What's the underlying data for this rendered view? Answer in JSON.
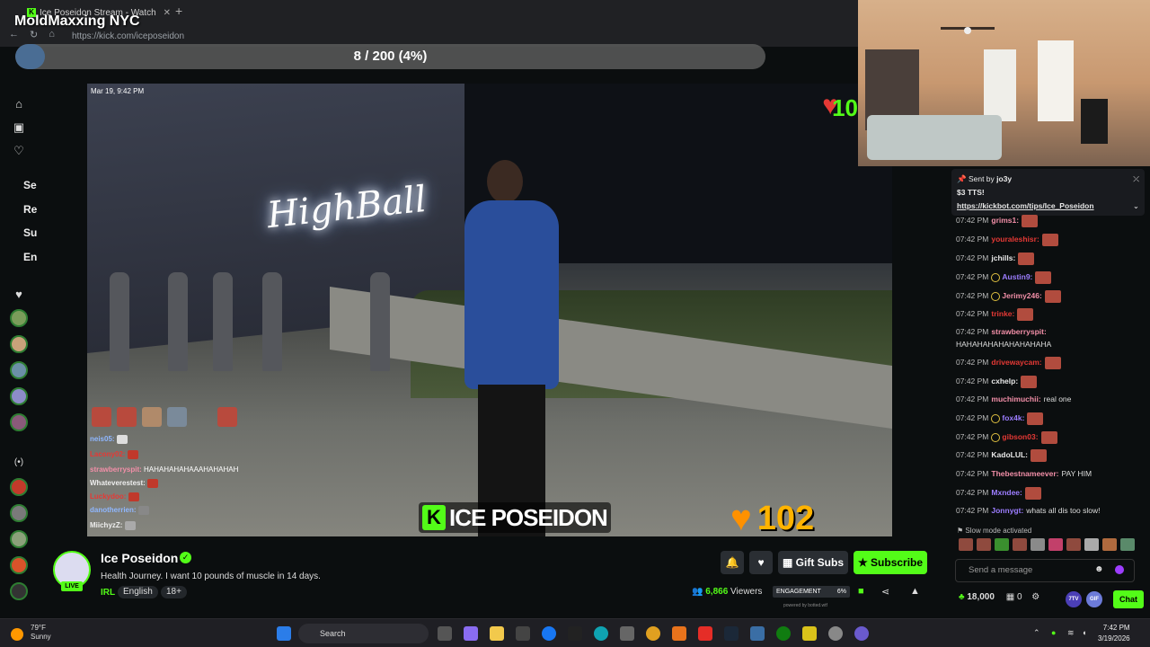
{
  "browser": {
    "tab_title": "Ice Poseidon Stream - Watch",
    "tab_close": "✕",
    "new_tab": "+",
    "url": "https://kick.com/iceposeidon"
  },
  "overlay": {
    "title": "MoldMaxxing NYC",
    "progress_text": "8 / 200 (4%)",
    "progress_fraction": 0.04
  },
  "sidebar": {
    "labels": [
      "Se",
      "Re",
      "Su",
      "En"
    ],
    "section_icon": "(•)"
  },
  "video": {
    "timestamp": "Mar 19, 9:42 PM",
    "sign_text": "HighBall",
    "heart_number": "10",
    "logo_k": "K",
    "logo_text": "ICE POSEIDON",
    "like_count": "102",
    "chat_overlay": [
      {
        "user": "neis05:",
        "text": ""
      },
      {
        "user": "Lacony02:",
        "text": ""
      },
      {
        "user": "strawberryspit:",
        "text": "HAHAHAHAHAAAHAHAHAH"
      },
      {
        "user": "Whateverestest:",
        "text": ""
      },
      {
        "user": "Luckydoo:",
        "text": ""
      },
      {
        "user": "danotherrien:",
        "text": ""
      },
      {
        "user": "MiichyzZ:",
        "text": ""
      }
    ]
  },
  "channel": {
    "name": "Ice Poseidon",
    "verified_mark": "✓",
    "live_label": "LIVE",
    "stream_title": "Health Journey. I want 10 pounds of muscle in 14 days.",
    "category": "IRL",
    "tags": [
      "English",
      "18+"
    ],
    "gift_label": "Gift Subs",
    "subscribe_label": "Subscribe",
    "viewers": "6,866",
    "viewers_label": "Viewers",
    "engagement_label": "ENGAGEMENT",
    "engagement_pct": "6%",
    "powered": "powered by botted.wtf"
  },
  "chat": {
    "pinned": {
      "sent_by_prefix": "Sent by",
      "sent_by_user": "jo3y",
      "amount": "$3 TTS!",
      "link": "https://kickbot.com/tips/Ice_Poseidon"
    },
    "messages": [
      {
        "time": "07:42 PM",
        "user": "grims1:",
        "text": "",
        "color": "#f28fa8",
        "badge": false,
        "emote": true
      },
      {
        "time": "07:42 PM",
        "user": "youraleshisr:",
        "text": "",
        "color": "#e53935",
        "badge": false,
        "emote": true
      },
      {
        "time": "07:42 PM",
        "user": "jchills:",
        "text": "",
        "color": "#e8e8e8",
        "badge": false,
        "emote": true
      },
      {
        "time": "07:42 PM",
        "user": "Austin9:",
        "text": "",
        "color": "#9c7dff",
        "badge": true,
        "emote": true
      },
      {
        "time": "07:42 PM",
        "user": "Jerimy246:",
        "text": "",
        "color": "#f28fa8",
        "badge": true,
        "emote": true
      },
      {
        "time": "07:42 PM",
        "user": "trinke:",
        "text": "",
        "color": "#e53935",
        "badge": false,
        "emote": true
      },
      {
        "time": "07:42 PM",
        "user": "strawberryspit:",
        "text": "HAHAHAHAHAHAHAHAHA",
        "color": "#f28fa8",
        "badge": false,
        "emote": false
      },
      {
        "time": "07:42 PM",
        "user": "drivewaycam:",
        "text": "",
        "color": "#e53935",
        "badge": false,
        "emote": true
      },
      {
        "time": "07:42 PM",
        "user": "cxhelp:",
        "text": "",
        "color": "#e8e8e8",
        "badge": false,
        "emote": true
      },
      {
        "time": "07:42 PM",
        "user": "muchimuchii:",
        "text": "real one",
        "color": "#f28fa8",
        "badge": false,
        "emote": false
      },
      {
        "time": "07:42 PM",
        "user": "fox4k:",
        "text": "",
        "color": "#9c7dff",
        "badge": true,
        "emote": true
      },
      {
        "time": "07:42 PM",
        "user": "gibson03:",
        "text": "",
        "color": "#e53935",
        "badge": true,
        "emote": true
      },
      {
        "time": "07:42 PM",
        "user": "KadoLUL:",
        "text": "",
        "color": "#e8e8e8",
        "badge": false,
        "emote": true
      },
      {
        "time": "07:42 PM",
        "user": "Thebestnameever:",
        "text": "PAY HIM",
        "color": "#f28fa8",
        "badge": false,
        "emote": false
      },
      {
        "time": "07:42 PM",
        "user": "Mxndee:",
        "text": "",
        "color": "#9c7dff",
        "badge": false,
        "emote": true
      },
      {
        "time": "07:42 PM",
        "user": "Jonnygt:",
        "text": "whats all dis too slow!",
        "color": "#9c7dff",
        "badge": false,
        "emote": false
      }
    ],
    "slow_mode": "Slow mode activated",
    "send_placeholder": "Send a message",
    "points": "18,000",
    "gifts": "0",
    "chat_button": "Chat",
    "pill_7tv": "7TV",
    "pill_gif": "GIF"
  },
  "taskbar": {
    "temp": "79°F",
    "condition": "Sunny",
    "search": "Search",
    "time": "7:42 PM",
    "date": "3/19/2026"
  }
}
